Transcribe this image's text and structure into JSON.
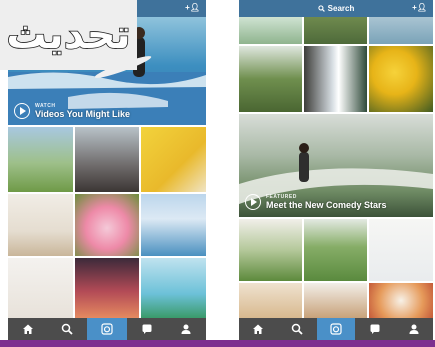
{
  "overlay_label": "تحديث",
  "left_phone": {
    "header": {
      "add_user_icon": "add-user-icon"
    },
    "feature": {
      "kicker": "WATCH",
      "title": "Videos You Might Like"
    }
  },
  "right_phone": {
    "header": {
      "search_label": "Search",
      "add_user_icon": "add-user-icon"
    },
    "feature": {
      "kicker": "FEATURED",
      "title": "Meet the New Comedy Stars"
    }
  },
  "tabs": [
    {
      "icon": "home-icon"
    },
    {
      "icon": "search-icon"
    },
    {
      "icon": "camera-icon",
      "active": true
    },
    {
      "icon": "activity-icon"
    },
    {
      "icon": "profile-icon"
    }
  ],
  "colors": {
    "header": "#3f729b",
    "tabbar": "#4c4c4c",
    "active_tab": "#4a90c8",
    "stripe": "#7d2f8f"
  }
}
